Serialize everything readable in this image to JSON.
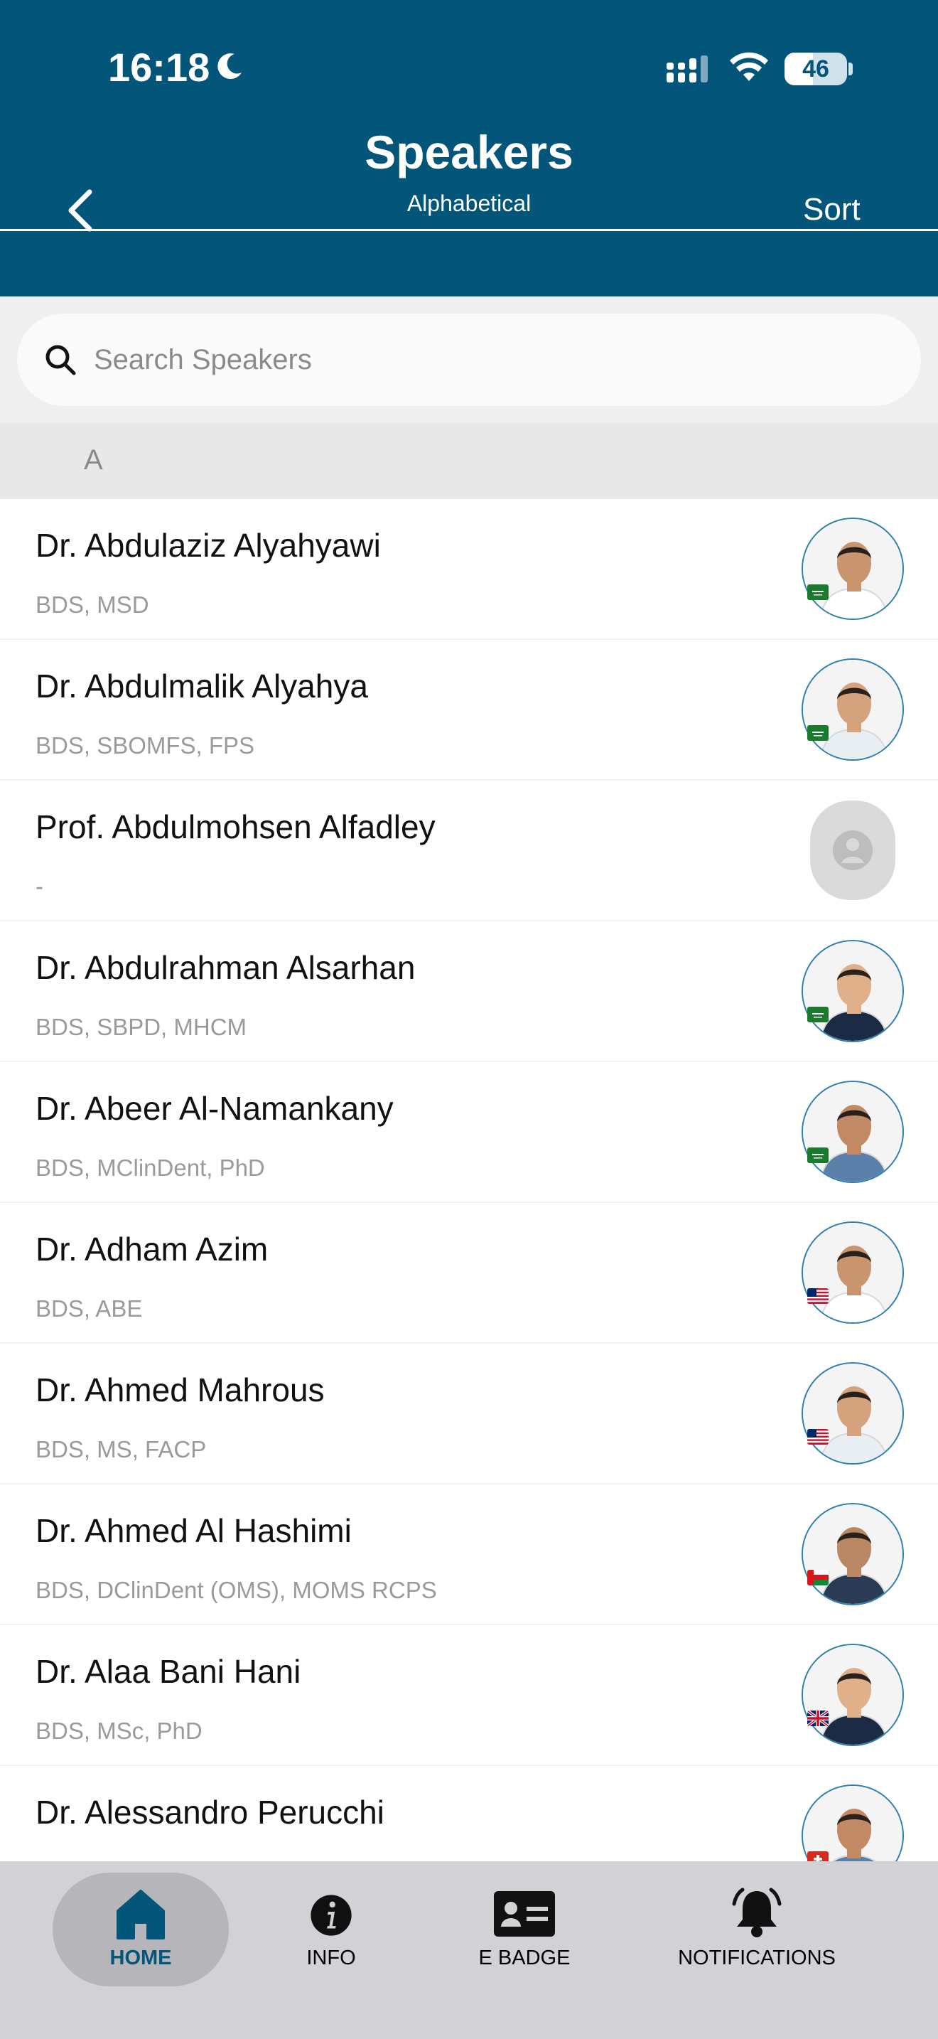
{
  "status_bar": {
    "time": "16:18",
    "battery": "46",
    "battery_level": 0.46
  },
  "header": {
    "title": "Speakers",
    "subtitle": "Alphabetical",
    "sort_label": "Sort"
  },
  "search": {
    "placeholder": "Search Speakers",
    "value": ""
  },
  "section": {
    "letter": "A"
  },
  "speakers": [
    {
      "name": "Dr. Abdulaziz Alyahyawi",
      "credentials": "BDS, MSD",
      "flag": "saudi",
      "photo": true
    },
    {
      "name": "Dr. Abdulmalik Alyahya",
      "credentials": "BDS, SBOMFS, FPS",
      "flag": "saudi",
      "photo": true
    },
    {
      "name": "Prof. Abdulmohsen Alfadley",
      "credentials": "-",
      "flag": "",
      "photo": false
    },
    {
      "name": "Dr. Abdulrahman Alsarhan",
      "credentials": "BDS, SBPD, MHCM",
      "flag": "saudi",
      "photo": true
    },
    {
      "name": "Dr. Abeer Al-Namankany",
      "credentials": "BDS, MClinDent, PhD",
      "flag": "saudi",
      "photo": true
    },
    {
      "name": "Dr. Adham Azim",
      "credentials": "BDS, ABE",
      "flag": "usa",
      "photo": true
    },
    {
      "name": "Dr. Ahmed Mahrous",
      "credentials": "BDS, MS, FACP",
      "flag": "usa",
      "photo": true
    },
    {
      "name": "Dr. Ahmed Al Hashimi",
      "credentials": "BDS, DClinDent (OMS), MOMS RCPS",
      "flag": "oman",
      "photo": true
    },
    {
      "name": "Dr. Alaa Bani Hani",
      "credentials": "BDS, MSc, PhD",
      "flag": "uk",
      "photo": true
    },
    {
      "name": "Dr. Alessandro Perucchi",
      "credentials": "",
      "flag": "switzerland",
      "photo": true
    }
  ],
  "bottom_nav": {
    "items": [
      {
        "label": "HOME",
        "icon": "home-icon",
        "active": true
      },
      {
        "label": "INFO",
        "icon": "info-icon",
        "active": false
      },
      {
        "label": "E BADGE",
        "icon": "badge-icon",
        "active": false
      },
      {
        "label": "NOTIFICATIONS",
        "icon": "bell-icon",
        "active": false
      }
    ]
  },
  "colors": {
    "header_bg": "#03557a",
    "active_nav": "#03557a",
    "nav_bg": "#d1d1d6"
  }
}
